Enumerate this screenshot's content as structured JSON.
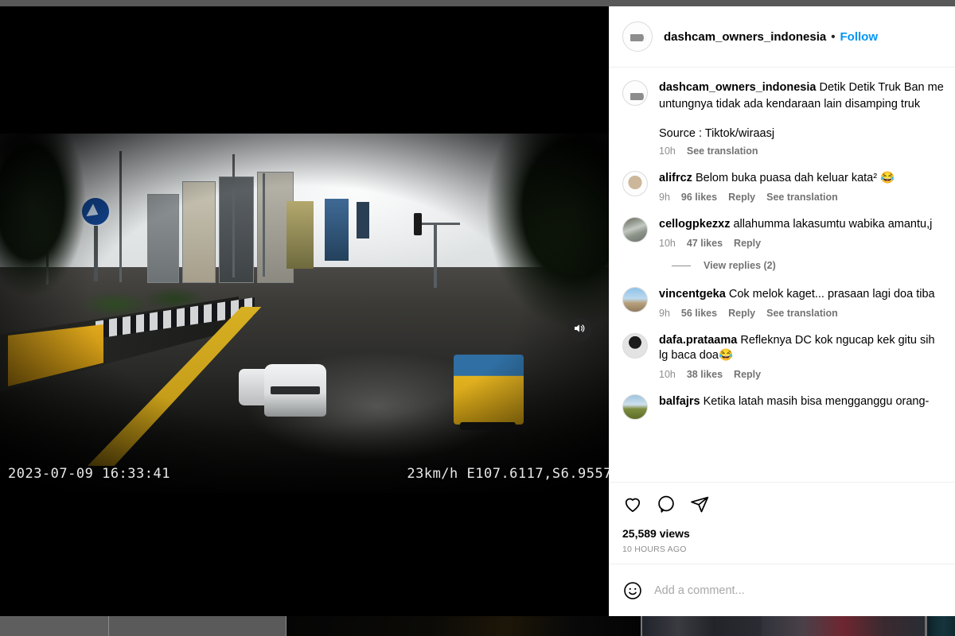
{
  "post": {
    "header": {
      "username": "dashcam_owners_indonesia",
      "separator": "•",
      "follow_label": "Follow",
      "avatar_icon": "dashcam-logo-avatar"
    },
    "caption": {
      "username": "dashcam_owners_indonesia",
      "line1": "Detik Detik Truk Ban me",
      "line2": "untungnya tidak ada kendaraan lain disamping truk",
      "source": "Source : Tiktok/wiraasj",
      "timestamp": "10h",
      "translate_label": "See translation"
    },
    "comments": [
      {
        "avatar": "avatar-alifrcz",
        "username": "alifrcz",
        "text": "Belom buka puasa dah keluar kata² 😂",
        "timestamp": "9h",
        "likes": "96 likes",
        "reply_label": "Reply",
        "translate_label": "See translation"
      },
      {
        "avatar": "avatar-cellogpkezxz",
        "username": "cellogpkezxz",
        "text": "allahumma lakasumtu wabika amantu,j",
        "timestamp": "10h",
        "likes": "47 likes",
        "reply_label": "Reply",
        "translate_label": "",
        "view_replies_label": "View replies (2)"
      },
      {
        "avatar": "avatar-vincentgeka",
        "username": "vincentgeka",
        "text": "Cok melok kaget... prasaan lagi doa tiba",
        "timestamp": "9h",
        "likes": "56 likes",
        "reply_label": "Reply",
        "translate_label": "See translation"
      },
      {
        "avatar": "avatar-dafa-prataama",
        "username": "dafa.prataama",
        "text": "Refleknya DC kok ngucap kek gitu sih",
        "text_line2": "lg baca doa😂",
        "timestamp": "10h",
        "likes": "38 likes",
        "reply_label": "Reply",
        "translate_label": ""
      },
      {
        "avatar": "avatar-balfajrs",
        "username": "balfajrs",
        "text": "Ketika latah masih bisa mengganggu orang-",
        "timestamp": "",
        "likes": "",
        "reply_label": "",
        "translate_label": ""
      }
    ],
    "actions": {
      "like_icon": "heart-icon",
      "comment_icon": "comment-bubble-icon",
      "share_icon": "share-paper-plane-icon"
    },
    "views": "25,589 views",
    "posted_ago": "10 HOURS AGO",
    "compose": {
      "emoji_icon": "smiley-face-icon",
      "placeholder": "Add a comment...",
      "value": ""
    }
  },
  "video": {
    "osd_timestamp": "2023-07-09 16:33:41",
    "osd_telemetry": "23km/h E107.6117,S6.9557",
    "sound_icon": "speaker-volume-icon"
  },
  "colors": {
    "accent_blue": "#0095f6",
    "text_primary": "#000000",
    "text_secondary": "#8e8e8e",
    "divider": "#efefef",
    "page_backdrop": "#1b1b1b"
  }
}
